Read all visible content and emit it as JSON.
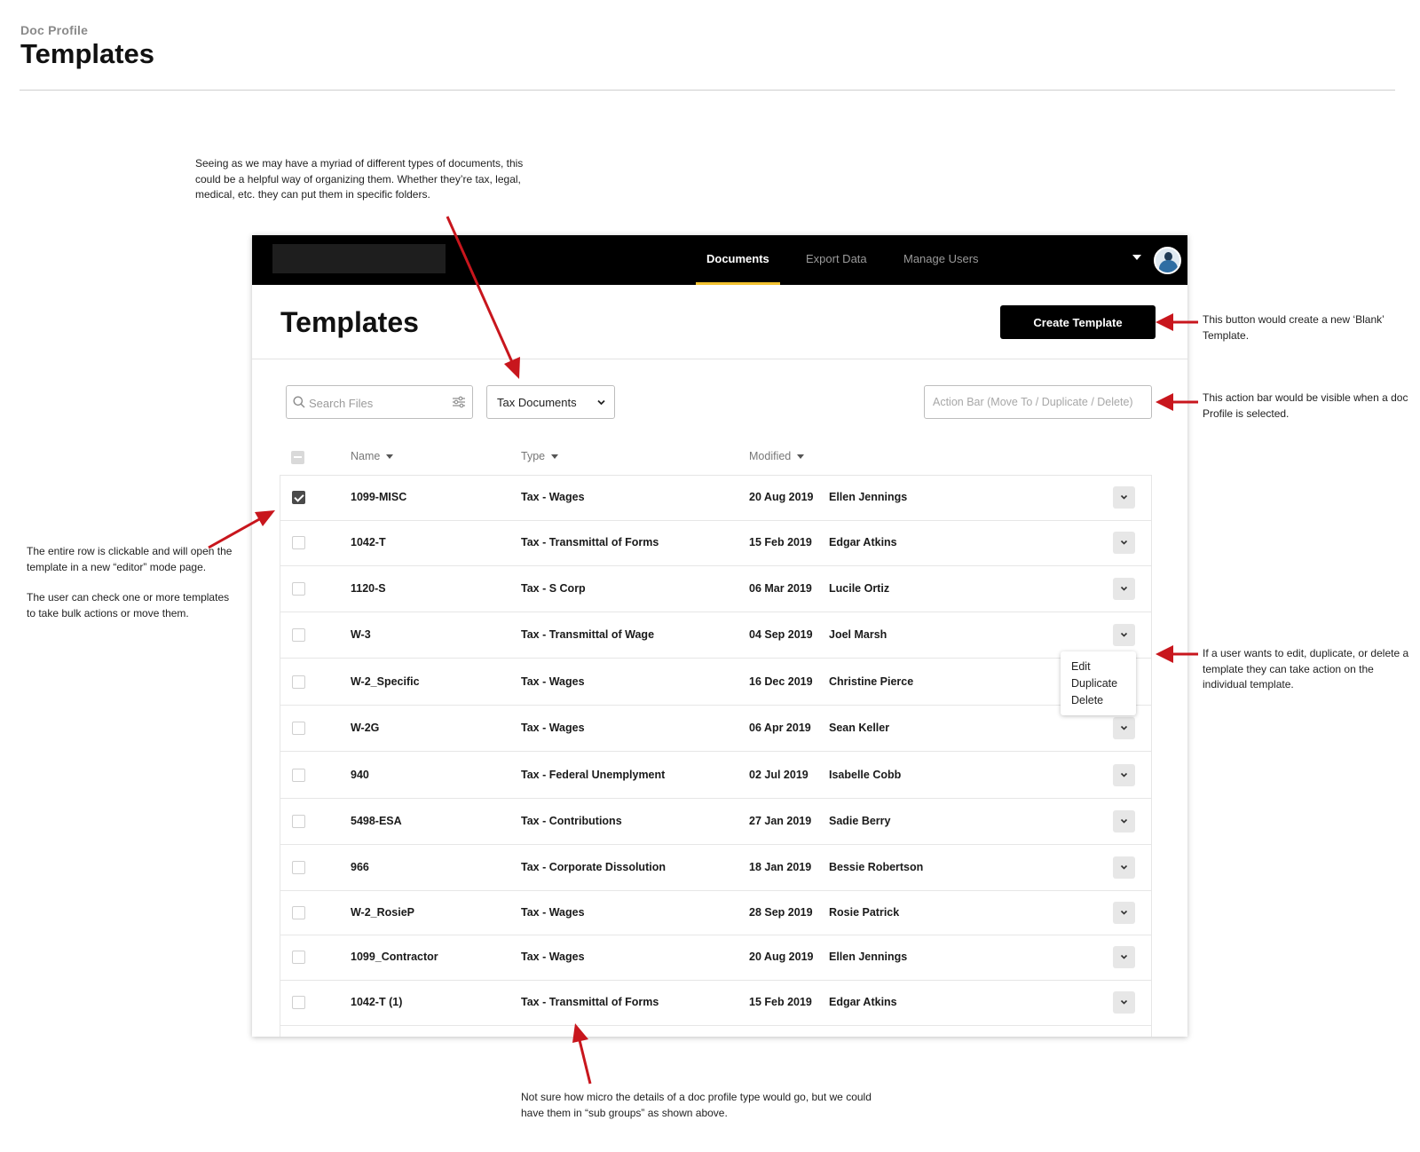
{
  "page": {
    "kicker": "Doc Profile",
    "title": "Templates"
  },
  "notes": {
    "folders": "Seeing as we may have a myriad of different types of documents, this could be a helpful way of organizing them. Whether they’re tax, legal, medical, etc. they can put them in specific folders.",
    "create": "This button would create a new ‘Blank’ Template.",
    "action_bar": "This action bar would be visible when a doc Profile is selected.",
    "row_click": "The entire row is clickable and will open the template in a new “editor” mode page.",
    "row_check": "The user can check one or more templates to take bulk actions or move them.",
    "row_menu": "If a user wants to edit, duplicate, or delete a template they can take action on the individual template.",
    "subgroups": "Not sure how micro the details of a doc profile type would go, but we could have them in “sub groups” as shown above."
  },
  "nav": {
    "items": [
      {
        "label": "Documents",
        "active": true
      },
      {
        "label": "Export Data",
        "active": false
      },
      {
        "label": "Manage Users",
        "active": false
      }
    ],
    "avatar_icon": "user-avatar-icon",
    "accent": "#f2c230"
  },
  "main": {
    "title": "Templates",
    "create_label": "Create Template",
    "search_placeholder": "Search Files",
    "type_select": "Tax Documents",
    "action_bar": "Action Bar (Move To / Duplicate / Delete)"
  },
  "table": {
    "columns": [
      "Name",
      "Type",
      "Modified"
    ],
    "rows": [
      {
        "name": "1099-MISC",
        "type": "Tax - Wages",
        "date": "20 Aug 2019",
        "user": "Ellen Jennings",
        "checked": true
      },
      {
        "name": "1042-T",
        "type": "Tax - Transmittal of Forms",
        "date": "15 Feb 2019",
        "user": "Edgar Atkins",
        "checked": false
      },
      {
        "name": "1120-S",
        "type": "Tax - S Corp",
        "date": "06 Mar 2019",
        "user": "Lucile Ortiz",
        "checked": false
      },
      {
        "name": "W-3",
        "type": "Tax - Transmittal of Wage",
        "date": "04 Sep 2019",
        "user": "Joel Marsh",
        "checked": false
      },
      {
        "name": "W-2_Specific",
        "type": "Tax - Wages",
        "date": "16 Dec 2019",
        "user": "Christine Pierce",
        "checked": false
      },
      {
        "name": "W-2G",
        "type": "Tax - Wages",
        "date": "06 Apr 2019",
        "user": "Sean Keller",
        "checked": false
      },
      {
        "name": "940",
        "type": "Tax - Federal Unemplyment",
        "date": "02 Jul 2019",
        "user": "Isabelle Cobb",
        "checked": false
      },
      {
        "name": "5498-ESA",
        "type": "Tax - Contributions",
        "date": "27 Jan 2019",
        "user": "Sadie Berry",
        "checked": false
      },
      {
        "name": "966",
        "type": "Tax - Corporate Dissolution",
        "date": "18 Jan 2019",
        "user": "Bessie Robertson",
        "checked": false
      },
      {
        "name": "W-2_RosieP",
        "type": "Tax - Wages",
        "date": "28 Sep 2019",
        "user": "Rosie Patrick",
        "checked": false
      },
      {
        "name": "1099_Contractor",
        "type": "Tax - Wages",
        "date": "20 Aug 2019",
        "user": "Ellen Jennings",
        "checked": false
      },
      {
        "name": "1042-T (1)",
        "type": "Tax - Transmittal of Forms",
        "date": "15 Feb 2019",
        "user": "Edgar Atkins",
        "checked": false
      }
    ],
    "row_menu": [
      "Edit",
      "Duplicate",
      "Delete"
    ]
  },
  "colors": {
    "annotation_arrow": "#c8161d",
    "topbar": "#000000"
  }
}
